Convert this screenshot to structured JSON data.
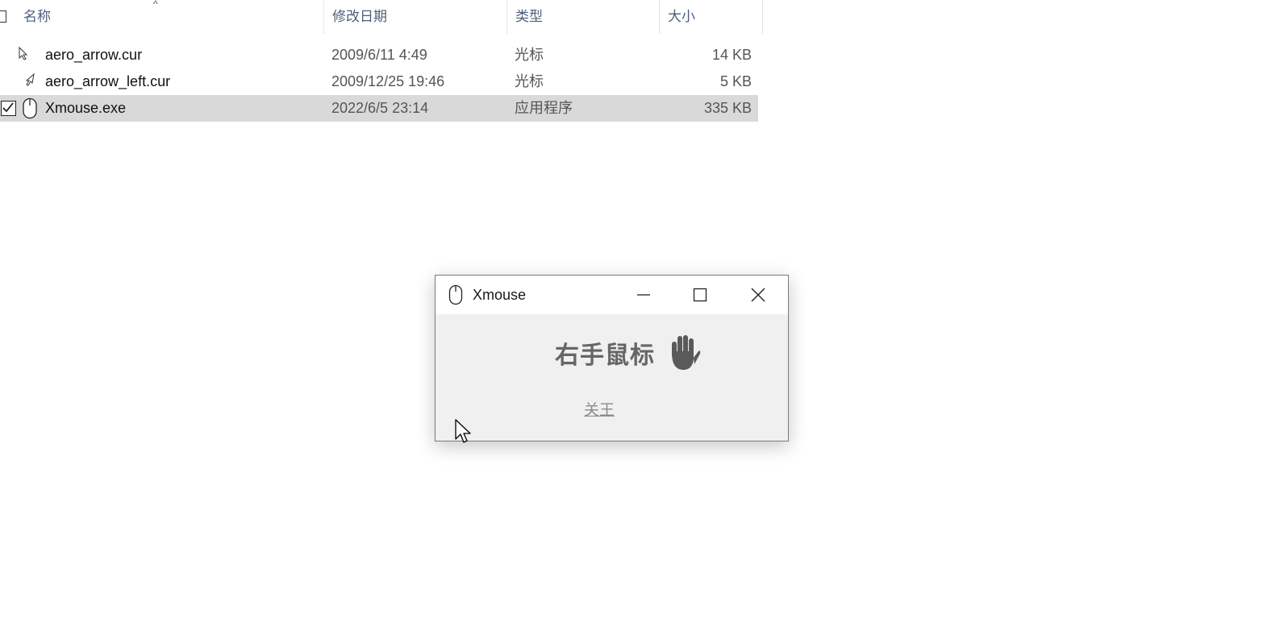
{
  "columns": [
    {
      "label": "名称"
    },
    {
      "label": "修改日期"
    },
    {
      "label": "类型"
    },
    {
      "label": "大小"
    }
  ],
  "files": [
    {
      "name": "aero_arrow.cur",
      "date": "2009/6/11 4:49",
      "type": "光标",
      "size": "14 KB",
      "icon": "cursor-file-icon",
      "selected": false
    },
    {
      "name": "aero_arrow_left.cur",
      "date": "2009/12/25 19:46",
      "type": "光标",
      "size": "5 KB",
      "icon": "left-cursor-file-icon",
      "selected": false
    },
    {
      "name": "Xmouse.exe",
      "date": "2022/6/5 23:14",
      "type": "应用程序",
      "size": "335 KB",
      "icon": "mouse-icon",
      "selected": true
    }
  ],
  "dialog": {
    "title": "Xmouse",
    "main_label": "右手鼠标",
    "close_label": "关王",
    "icon": "mouse-icon",
    "hand_icon": "hand-icon"
  },
  "colors": {
    "selected_row": "#d9d9d9",
    "header_text": "#4c607a",
    "dialog_bg": "#f0f0f0",
    "label_gray": "#666666"
  }
}
